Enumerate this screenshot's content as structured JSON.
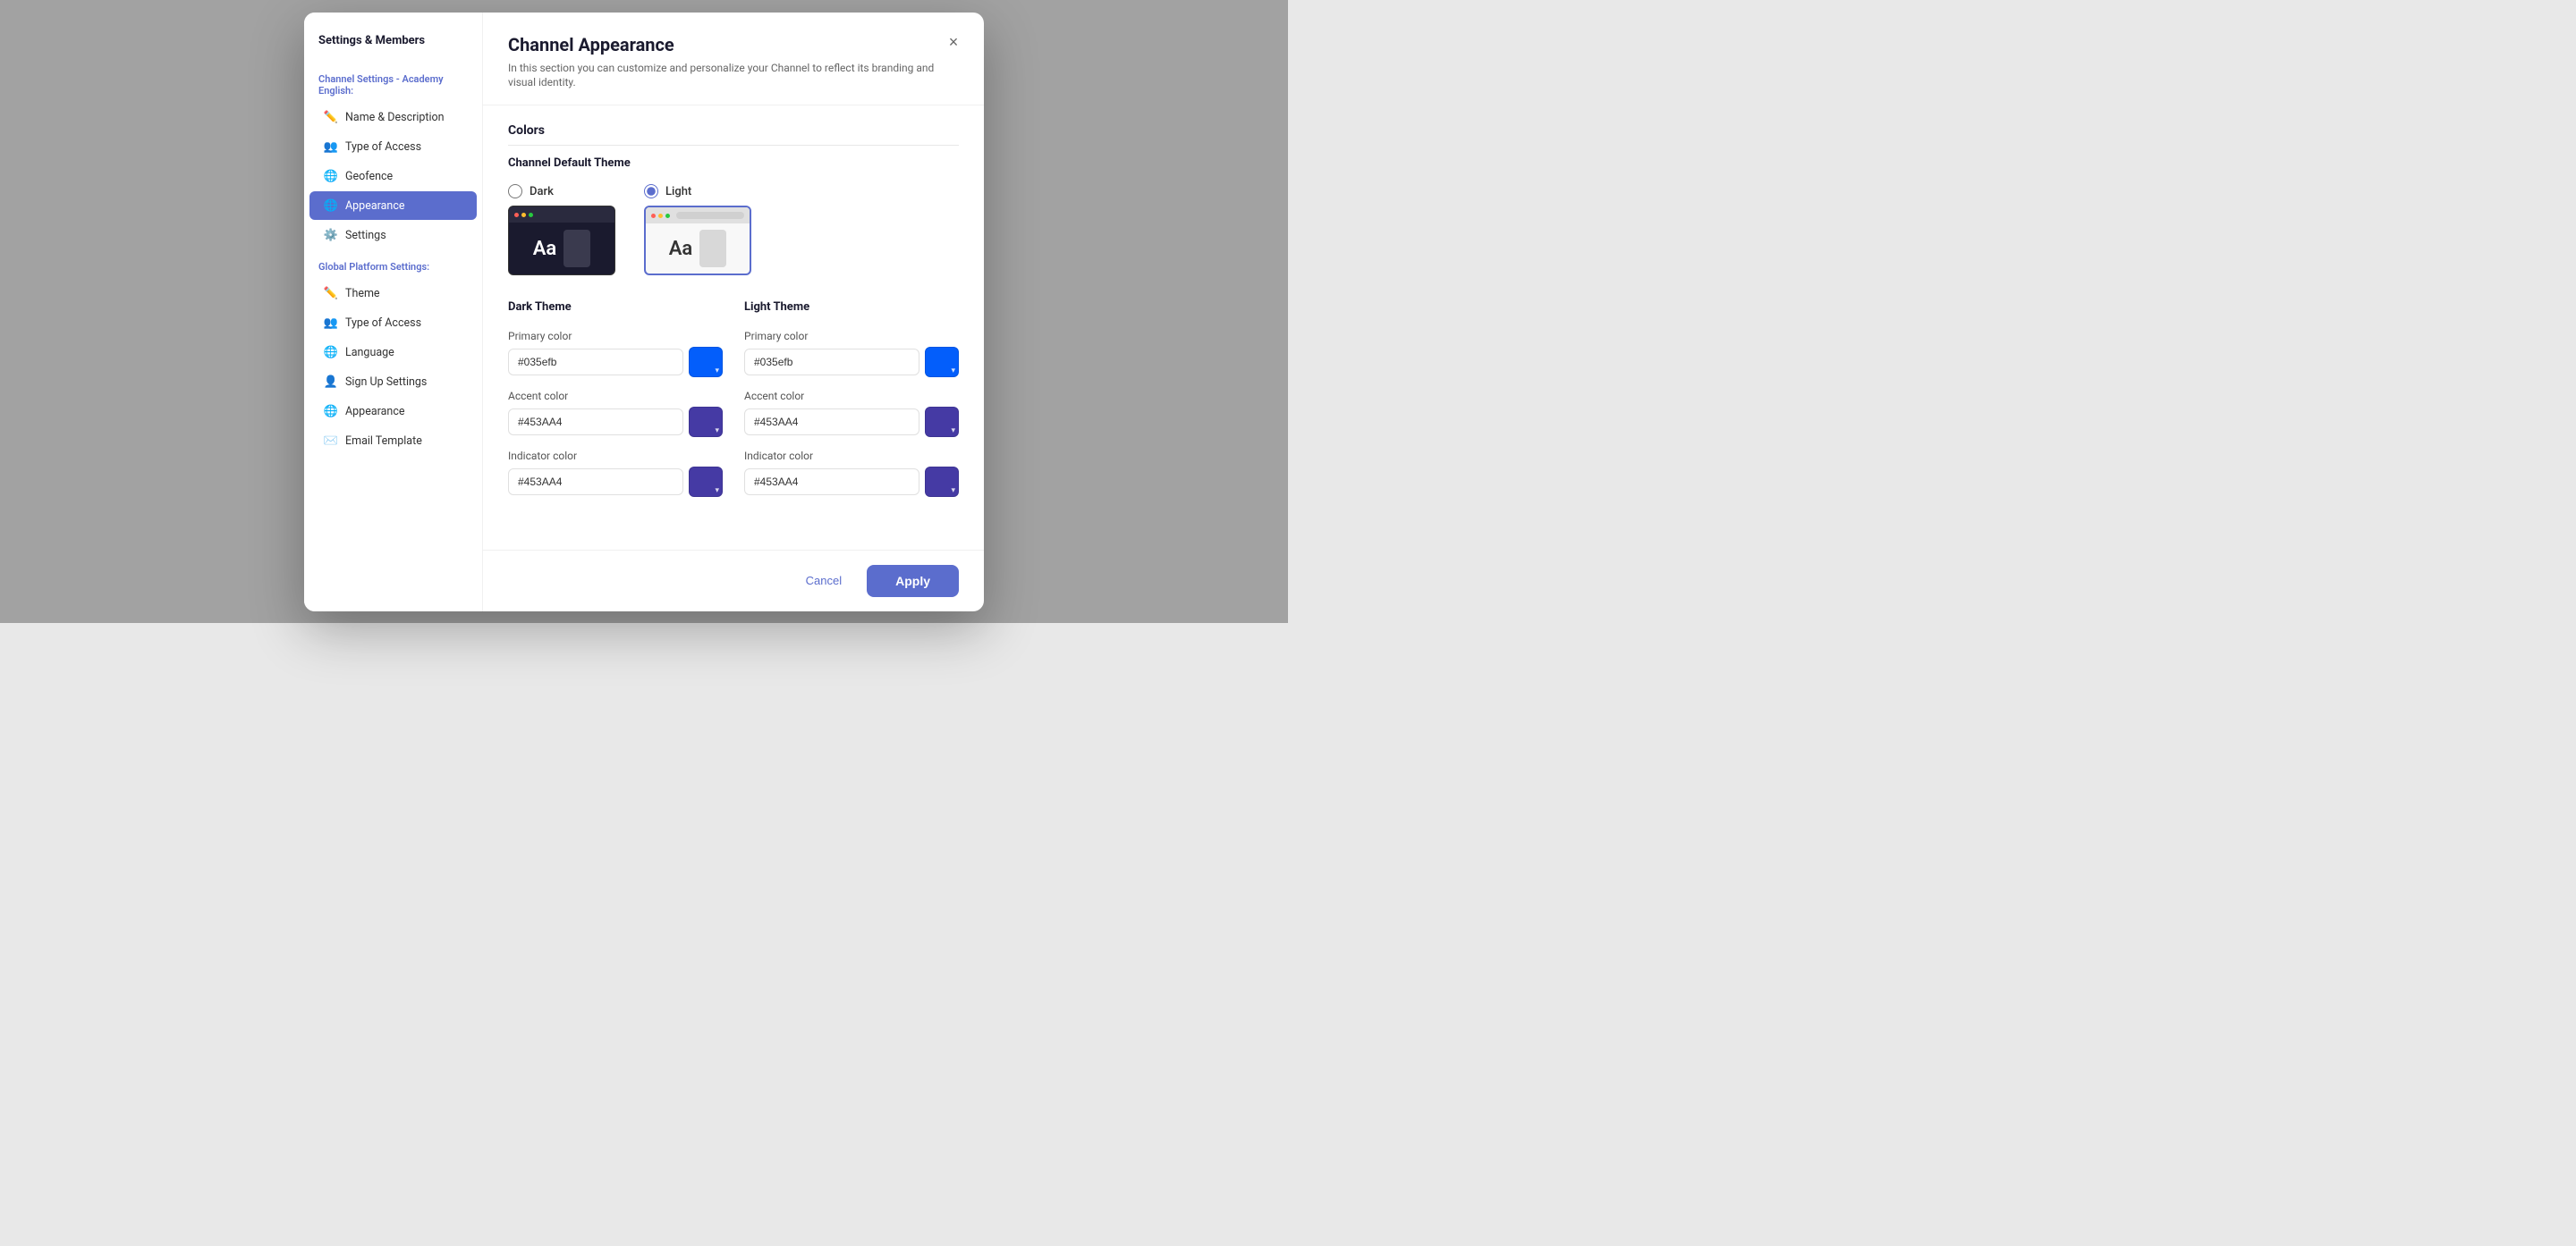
{
  "modal": {
    "title": "Channel Appearance",
    "subtitle": "In this section you can customize and personalize your Channel to reflect its branding and visual identity.",
    "close_label": "×"
  },
  "sidebar": {
    "title": "Settings & Members",
    "channel_section_label": "Channel Settings - Academy English:",
    "channel_items": [
      {
        "id": "name-description",
        "label": "Name & Description",
        "icon": "pencil"
      },
      {
        "id": "type-of-access",
        "label": "Type of Access",
        "icon": "users"
      },
      {
        "id": "geofence",
        "label": "Geofence",
        "icon": "globe"
      },
      {
        "id": "appearance",
        "label": "Appearance",
        "icon": "globe-circle",
        "active": true
      }
    ],
    "settings_item": {
      "id": "settings",
      "label": "Settings",
      "icon": "gear"
    },
    "global_section_label": "Global Platform Settings:",
    "global_items": [
      {
        "id": "theme",
        "label": "Theme",
        "icon": "pencil"
      },
      {
        "id": "type-of-access-global",
        "label": "Type of Access",
        "icon": "users"
      },
      {
        "id": "language",
        "label": "Language",
        "icon": "globe"
      },
      {
        "id": "sign-up-settings",
        "label": "Sign Up Settings",
        "icon": "user"
      },
      {
        "id": "appearance-global",
        "label": "Appearance",
        "icon": "globe-circle"
      },
      {
        "id": "email-template",
        "label": "Email Template",
        "icon": "envelope"
      }
    ]
  },
  "content": {
    "colors_label": "Colors",
    "theme_title": "Channel Default Theme",
    "dark_label": "Dark",
    "light_label": "Light",
    "dark_selected": false,
    "light_selected": true,
    "dark_theme": {
      "title": "Dark Theme",
      "primary_color_label": "Primary color",
      "primary_color_value": "#035efb",
      "accent_color_label": "Accent color",
      "accent_color_value": "#453AA4",
      "indicator_color_label": "Indicator color",
      "indicator_color_value": "#453AA4"
    },
    "light_theme": {
      "title": "Light Theme",
      "primary_color_label": "Primary color",
      "primary_color_value": "#035efb",
      "accent_color_label": "Accent color",
      "accent_color_value": "#453AA4",
      "indicator_color_label": "Indicator color",
      "indicator_color_value": "#453AA4"
    }
  },
  "footer": {
    "cancel_label": "Cancel",
    "apply_label": "Apply"
  },
  "colors": {
    "primary": "#035efb",
    "accent": "#453AA4",
    "indicator": "#453AA4",
    "sidebar_active": "#5b6dcd"
  }
}
